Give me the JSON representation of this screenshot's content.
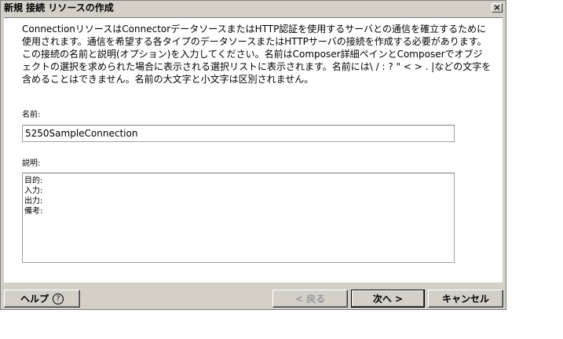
{
  "window": {
    "title": "新規 接続 リソースの作成",
    "close_symbol": "×"
  },
  "description_text": "ConnectionリソースはConnectorデータソースまたはHTTP認証を使用するサーバとの通信を確立するために使用されます。通信を希望する各タイプのデータソースまたはHTTPサーバの接続を作成する必要があります。この接続の名前と説明(オプション)を入力してください。名前はComposer詳細ペインとComposerでオブジェクトの選択を求められた場合に表示される選択リストに表示されます。名前には\\ / : ? \" < > . |などの文字を含めることはできません。名前の大文字と小文字は区別されません。",
  "name_field": {
    "label": "名前:",
    "value": "5250SampleConnection"
  },
  "desc_field": {
    "label": "説明:",
    "value": "目的:\n入力:\n出力:\n備考:"
  },
  "buttons": {
    "help": "ヘルプ",
    "help_icon_glyph": "?",
    "back": "< 戻る",
    "next": "次へ >",
    "cancel": "キャンセル"
  },
  "icons": {
    "close": "close-icon",
    "help": "help-icon"
  }
}
